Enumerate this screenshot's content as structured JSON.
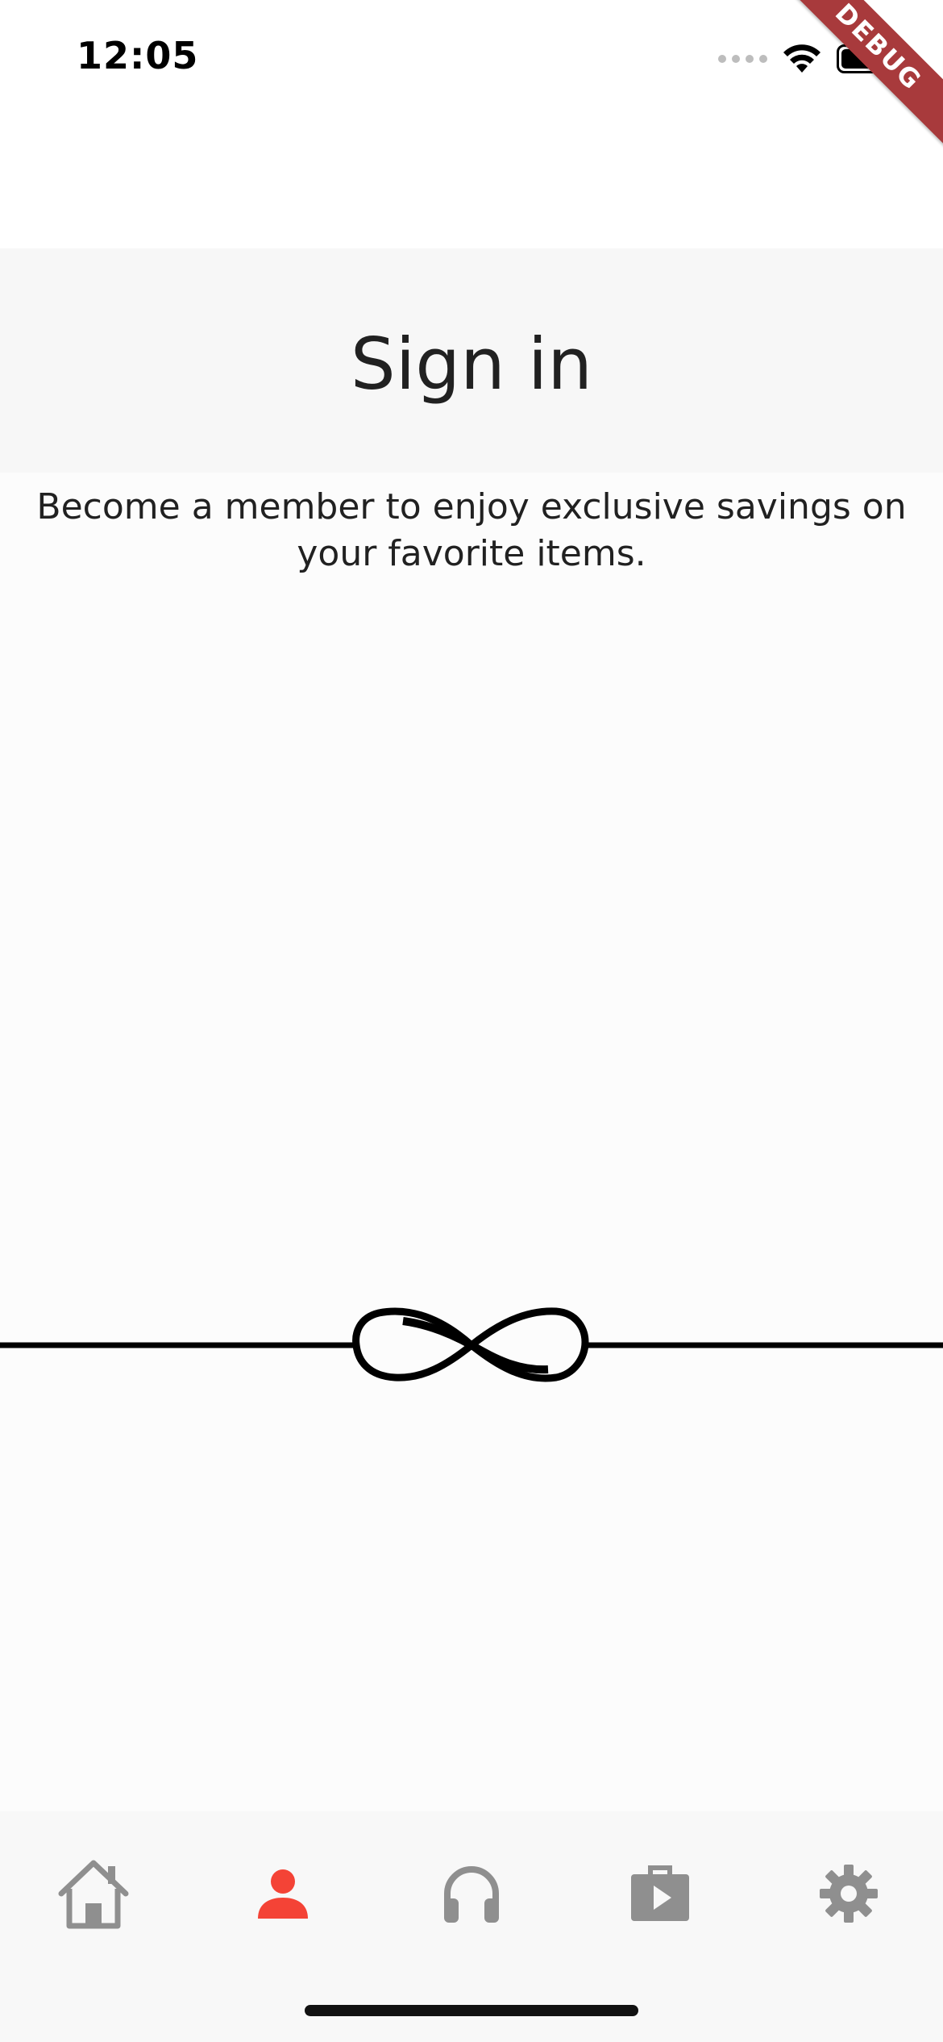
{
  "status_bar": {
    "time": "12:05",
    "icons": [
      "cellular-signal-icon",
      "wifi-icon",
      "battery-icon"
    ]
  },
  "debug_banner": "DEBUG",
  "header": {
    "title": "Sign in"
  },
  "main": {
    "subtitle": "Become a member to enjoy exclusive savings on your favorite items.",
    "divider_icon": "infinity-icon"
  },
  "bottom_nav": {
    "active_index": 1,
    "items": [
      {
        "icon": "home-icon",
        "active": false
      },
      {
        "icon": "person-icon",
        "active": true
      },
      {
        "icon": "headphones-icon",
        "active": false
      },
      {
        "icon": "briefcase-play-icon",
        "active": false
      },
      {
        "icon": "gear-icon",
        "active": false
      }
    ]
  },
  "colors": {
    "accent": "#f44336",
    "inactive_icon": "#8f8f8f",
    "header_bg": "#f7f7f7",
    "nav_bg": "#f8f8f8",
    "debug_ribbon": "#a83a3c"
  }
}
